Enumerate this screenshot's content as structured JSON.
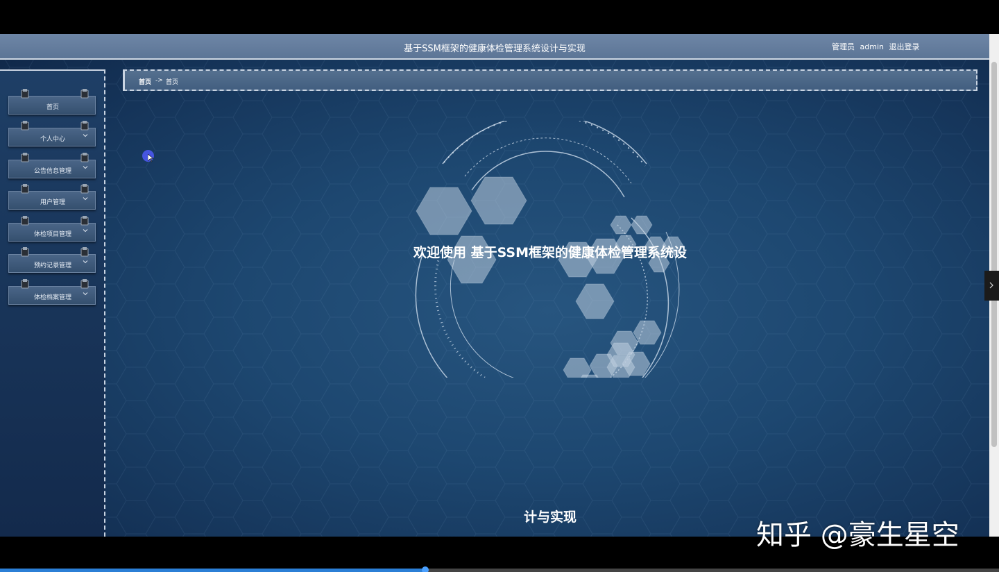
{
  "header": {
    "title": "基于SSM框架的健康体检管理系统设计与实现",
    "user_role": "管理员",
    "username": "admin",
    "logout": "退出登录"
  },
  "sidebar": {
    "items": [
      {
        "label": "首页",
        "has_submenu": false,
        "icon": "none"
      },
      {
        "label": "个人中心",
        "has_submenu": true,
        "icon": "chevron-down-icon"
      },
      {
        "label": "公告信息管理",
        "has_submenu": true,
        "icon": "chevron-down-icon"
      },
      {
        "label": "用户管理",
        "has_submenu": true,
        "icon": "chevron-down-icon"
      },
      {
        "label": "体检项目管理",
        "has_submenu": true,
        "icon": "chevron-down-icon"
      },
      {
        "label": "预约记录管理",
        "has_submenu": true,
        "icon": "chevron-down-icon"
      },
      {
        "label": "体检档案管理",
        "has_submenu": true,
        "icon": "chevron-down-icon"
      }
    ]
  },
  "breadcrumb": {
    "home": "首页",
    "separator": "->",
    "current": "首页"
  },
  "welcome": {
    "line1": "欢迎使用 基于SSM框架的健康体检管理系统设",
    "line2": "计与实现"
  },
  "watermark": "知乎 @豪生星空",
  "video": {
    "progress": 0.426
  },
  "colors": {
    "topbar": "#5c7596",
    "background": "#1d4770",
    "menu_item": "#3f5a7b",
    "progress": "#2b7fd6"
  }
}
